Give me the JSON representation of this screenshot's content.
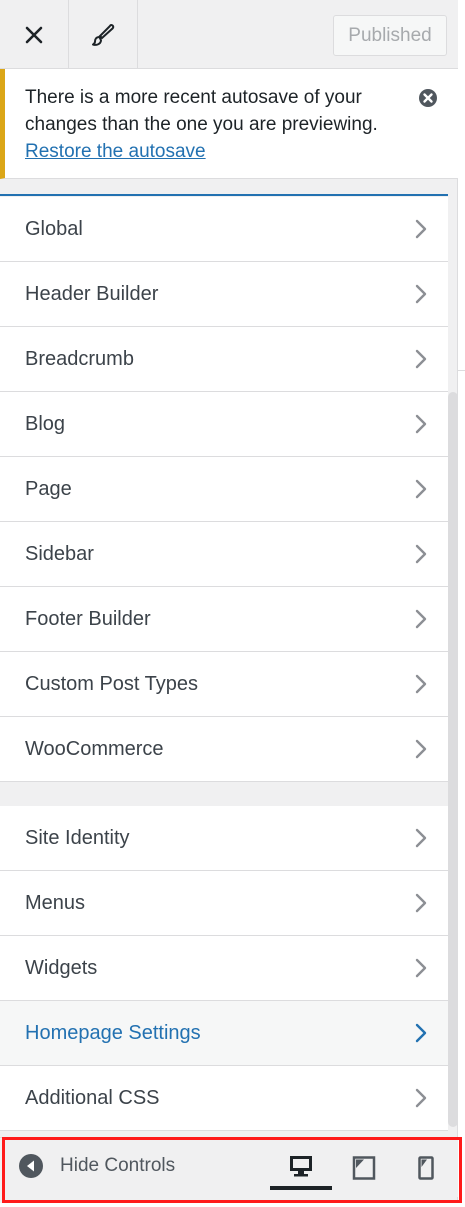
{
  "header": {
    "close_icon": "close-icon",
    "customize_icon": "paintbrush-icon",
    "publish_label": "Published"
  },
  "notice": {
    "message": "There is a more recent autosave of your changes than the one you are previewing.",
    "link_text": "Restore the autosave",
    "border_color": "#dba617",
    "dismiss_icon": "dismiss-icon"
  },
  "theme_panels": [
    {
      "label": "Global"
    },
    {
      "label": "Header Builder"
    },
    {
      "label": "Breadcrumb"
    },
    {
      "label": "Blog"
    },
    {
      "label": "Page"
    },
    {
      "label": "Sidebar"
    },
    {
      "label": "Footer Builder"
    },
    {
      "label": "Custom Post Types"
    },
    {
      "label": "WooCommerce"
    }
  ],
  "core_panels": [
    {
      "label": "Site Identity"
    },
    {
      "label": "Menus"
    },
    {
      "label": "Widgets"
    },
    {
      "label": "Homepage Settings",
      "active": true
    },
    {
      "label": "Additional CSS"
    }
  ],
  "footer": {
    "hide_controls_label": "Hide Controls",
    "devices": [
      {
        "name": "desktop",
        "active": true
      },
      {
        "name": "tablet",
        "active": false
      },
      {
        "name": "mobile",
        "active": false
      }
    ],
    "highlight_color": "#ff1a1a"
  },
  "colors": {
    "accent": "#2271b1",
    "text": "#3c434a",
    "chevron": "#8c8f94"
  }
}
